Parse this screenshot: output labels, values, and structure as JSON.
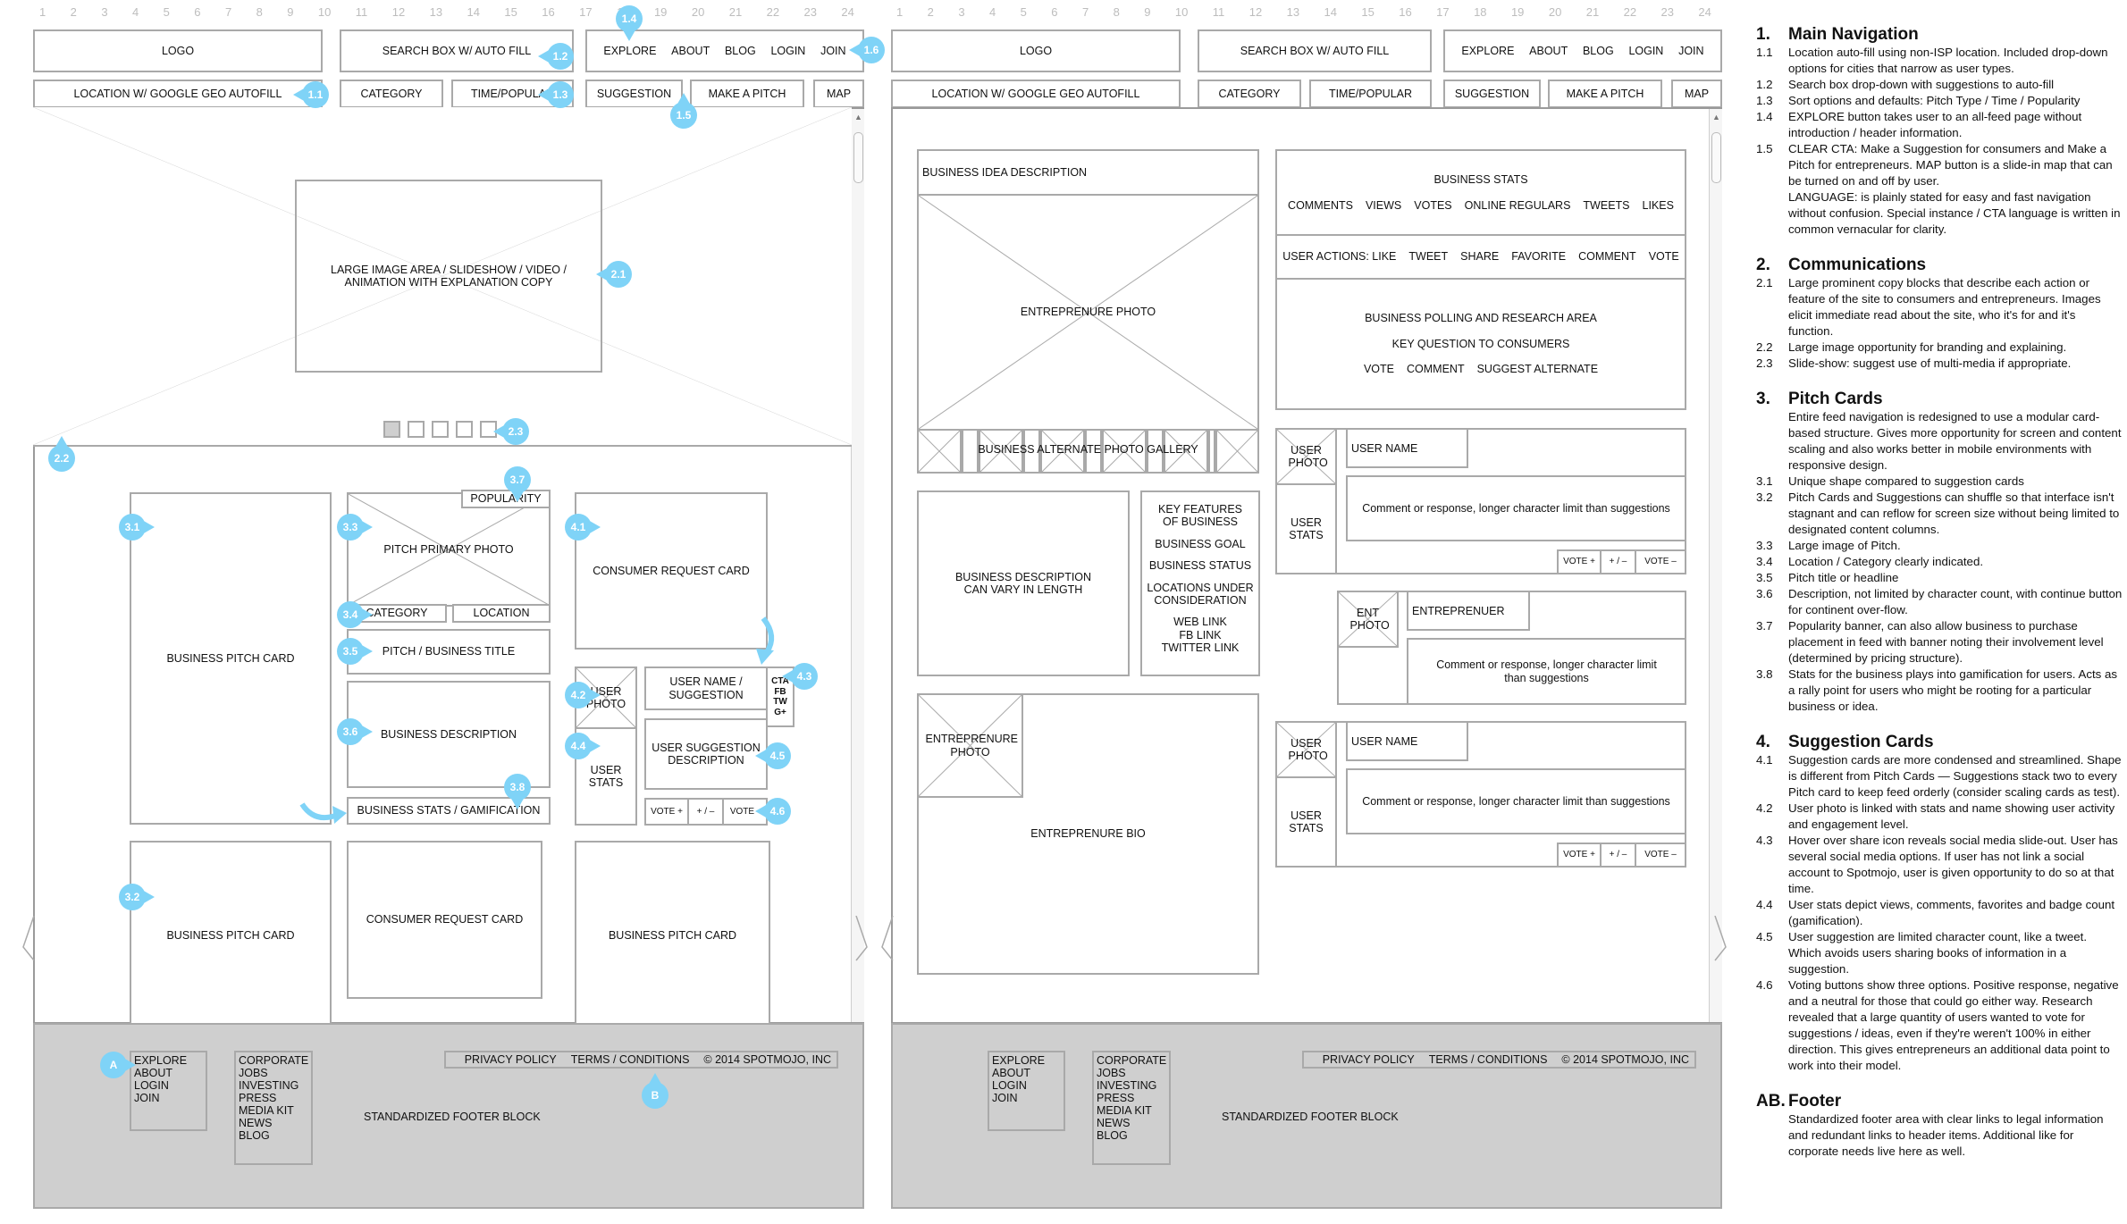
{
  "grid_columns": [
    "1",
    "2",
    "3",
    "4",
    "5",
    "6",
    "7",
    "8",
    "9",
    "10",
    "11",
    "12",
    "13",
    "14",
    "15",
    "16",
    "17",
    "18",
    "19",
    "20",
    "21",
    "22",
    "23",
    "24"
  ],
  "header": {
    "logo": "LOGO",
    "search": "SEARCH BOX W/ AUTO FILL",
    "nav_links": [
      "EXPLORE",
      "ABOUT",
      "BLOG",
      "LOGIN",
      "JOIN"
    ],
    "location": "LOCATION W/ GOOGLE GEO AUTOFILL",
    "category": "CATEGORY",
    "time_popular": "TIME/POPULAR",
    "suggestion": "SUGGESTION",
    "make_pitch": "MAKE A PITCH",
    "map": "MAP"
  },
  "home": {
    "hero_text": "LARGE IMAGE AREA / SLIDESHOW / VIDEO / ANIMATION WITH EXPLANATION COPY",
    "slideshow": {
      "total_slides": 5,
      "active_slide": 1
    },
    "business_pitch_card": "BUSINESS PITCH CARD",
    "consumer_request_card": "CONSUMER REQUEST CARD",
    "pitch_card": {
      "popularity": "POPULARITY",
      "photo": "PITCH PRIMARY PHOTO",
      "category": "CATEGORY",
      "location": "LOCATION",
      "title": "PITCH / BUSINESS TITLE",
      "description": "BUSINESS DESCRIPTION",
      "stats": "BUSINESS STATS / GAMIFICATION"
    },
    "suggestion_card": {
      "user_photo": "USER PHOTO",
      "user_name": "USER NAME / SUGGESTION",
      "share": [
        "CTA",
        "FB",
        "TW",
        "G+"
      ],
      "description": "USER SUGGESTION DESCRIPTION",
      "user_stats": "USER STATS",
      "vote_plus": "VOTE +",
      "vote_neutral": "+ / –",
      "vote_minus": "VOTE -"
    }
  },
  "detail": {
    "idea_description": "BUSINESS IDEA DESCRIPTION",
    "entrepreneur_photo": "ENTREPRENURE PHOTO",
    "gallery": "BUSINESS ALTERNATE PHOTO GALLERY",
    "business_stats_title": "BUSINESS STATS",
    "business_stats": [
      "COMMENTS",
      "VIEWS",
      "VOTES",
      "ONLINE REGULARS",
      "TWEETS",
      "LIKES"
    ],
    "user_actions": [
      "USER ACTIONS: LIKE",
      "TWEET",
      "SHARE",
      "FAVORITE",
      "COMMENT",
      "VOTE"
    ],
    "polling_title": "BUSINESS POLLING AND RESEARCH AREA",
    "polling_question": "KEY QUESTION TO CONSUMERS",
    "polling_actions": [
      "VOTE",
      "COMMENT",
      "SUGGEST ALTERNATE"
    ],
    "business_description": "BUSINESS DESCRIPTION CAN VARY IN LENGTH",
    "key_features": [
      "KEY FEATURES OF BUSINESS",
      "BUSINESS GOAL",
      "BUSINESS STATUS",
      "LOCATIONS UNDER CONSIDERATION",
      "WEB LINK\nFB LINK\nTWITTER LINK"
    ],
    "entrepreneur_photo_small": "ENTREPRENURE PHOTO",
    "entrepreneur_bio": "ENTREPRENURE BIO",
    "comments": [
      {
        "photo": "USER PHOTO",
        "name": "USER NAME",
        "stats": "USER STATS",
        "text": "Comment or response, longer character limit than suggestions",
        "votes": [
          "VOTE +",
          "+ / –",
          "VOTE –"
        ]
      },
      {
        "photo": "ENT PHOTO",
        "name": "ENTREPRENUER",
        "text": "Comment or response, longer character limit than suggestions"
      },
      {
        "photo": "USER PHOTO",
        "name": "USER NAME",
        "stats": "USER STATS",
        "text": "Comment or response, longer character limit than suggestions",
        "votes": [
          "VOTE +",
          "+ / –",
          "VOTE –"
        ]
      }
    ]
  },
  "footer": {
    "nav_links": [
      "EXPLORE",
      "ABOUT",
      "LOGIN",
      "JOIN"
    ],
    "corporate_links": [
      "CORPORATE",
      "JOBS",
      "INVESTING",
      "PRESS",
      "MEDIA KIT",
      "NEWS",
      "BLOG"
    ],
    "legal_links": [
      "PRIVACY POLICY",
      "TERMS / CONDITIONS",
      "© 2014 SPOTMOJO, INC"
    ],
    "label": "STANDARDIZED FOOTER BLOCK"
  },
  "markers": {
    "m1_1": "1.1",
    "m1_2": "1.2",
    "m1_3": "1.3",
    "m1_4": "1.4",
    "m1_5": "1.5",
    "m1_6": "1.6",
    "m2_1": "2.1",
    "m2_2": "2.2",
    "m2_3": "2.3",
    "m3_1": "3.1",
    "m3_2": "3.2",
    "m3_3": "3.3",
    "m3_4": "3.4",
    "m3_5": "3.5",
    "m3_6": "3.6",
    "m3_7": "3.7",
    "m3_8": "3.8",
    "m4_1": "4.1",
    "m4_2": "4.2",
    "m4_3": "4.3",
    "m4_4": "4.4",
    "m4_5": "4.5",
    "m4_6": "4.6",
    "mA": "A",
    "mB": "B"
  },
  "accent_color": "#7fd3f7",
  "notes": [
    {
      "num": "1.",
      "title": "Main Navigation",
      "items": [
        {
          "num": "1.1",
          "text": "Location auto-fill using non-ISP location. Included drop-down options for cities that narrow as user types."
        },
        {
          "num": "1.2",
          "text": "Search box drop-down with suggestions to auto-fill"
        },
        {
          "num": "1.3",
          "text": "Sort options and defaults: Pitch Type / Time / Popularity"
        },
        {
          "num": "1.4",
          "text": "EXPLORE button takes user to an all-feed page without introduction / header information."
        },
        {
          "num": "1.5",
          "text": "CLEAR CTA: Make a Suggestion for consumers and Make a Pitch for entrepreneurs. MAP button is a slide-in map that can be turned on and off by user."
        },
        {
          "num": "",
          "text": "LANGUAGE: is plainly stated for easy and fast navigation without confusion. Special instance / CTA language is written in common vernacular for clarity."
        }
      ]
    },
    {
      "num": "2.",
      "title": "Communications",
      "items": [
        {
          "num": "2.1",
          "text": "Large prominent copy blocks that describe each action or feature of the site to consumers and entrepreneurs. Images elicit immediate read about the site, who it's for and it's function."
        },
        {
          "num": "2.2",
          "text": "Large image opportunity for branding and explaining."
        },
        {
          "num": "2.3",
          "text": "Slide-show: suggest use of multi-media if appropriate."
        }
      ]
    },
    {
      "num": "3.",
      "title": "Pitch Cards",
      "items": [
        {
          "num": "",
          "text": "Entire feed navigation is redesigned to use a modular card-based structure. Gives more opportunity for screen and content scaling and also works better in mobile environments with responsive design."
        },
        {
          "num": "3.1",
          "text": "Unique shape compared to suggestion cards"
        },
        {
          "num": "3.2",
          "text": "Pitch Cards and Suggestions can shuffle so that interface isn't stagnant and can reflow for screen size without being limited to designated content columns."
        },
        {
          "num": "3.3",
          "text": "Large image of Pitch."
        },
        {
          "num": "3.4",
          "text": "Location / Category clearly indicated."
        },
        {
          "num": "3.5",
          "text": "Pitch title or headline"
        },
        {
          "num": "3.6",
          "text": "Description, not limited by character count, with continue button for continent over-flow."
        },
        {
          "num": "3.7",
          "text": "Popularity banner, can also allow business to purchase placement in feed with banner noting their involvement level (determined by pricing structure)."
        },
        {
          "num": "3.8",
          "text": "Stats for the business plays into gamification for users. Acts as a rally point for users who might be rooting for a particular business or idea."
        }
      ]
    },
    {
      "num": "4.",
      "title": "Suggestion Cards",
      "items": [
        {
          "num": "4.1",
          "text": "Suggestion cards are more condensed and streamlined. Shape is different from Pitch Cards — Suggestions stack two to every Pitch card to keep feed orderly (consider scaling cards as test)."
        },
        {
          "num": "4.2",
          "text": "User photo is linked with stats and name showing user activity and engagement level."
        },
        {
          "num": "4.3",
          "text": "Hover over share icon reveals social media slide-out. User has several social media options. If user has not link a social account to Spotmojo, user is given opportunity to do so at that time."
        },
        {
          "num": "4.4",
          "text": "User stats depict views, comments, favorites and badge count (gamification)."
        },
        {
          "num": "4.5",
          "text": "User suggestion are limited character count, like a tweet. Which avoids users sharing books of information in a suggestion."
        },
        {
          "num": "4.6",
          "text": "Voting buttons show three options. Positive response, negative and a neutral for those that could go either way. Research revealed that a large quantity of users wanted to vote for suggestions / ideas, even if they're weren't 100% in either direction. This gives entrepreneurs an additional data point to work into their model."
        }
      ]
    },
    {
      "num": "AB.",
      "title": "Footer",
      "items": [
        {
          "num": "",
          "text": "Standardized footer area with clear links to legal information and redundant links to header items. Additional like for corporate needs live here as well."
        }
      ]
    }
  ]
}
